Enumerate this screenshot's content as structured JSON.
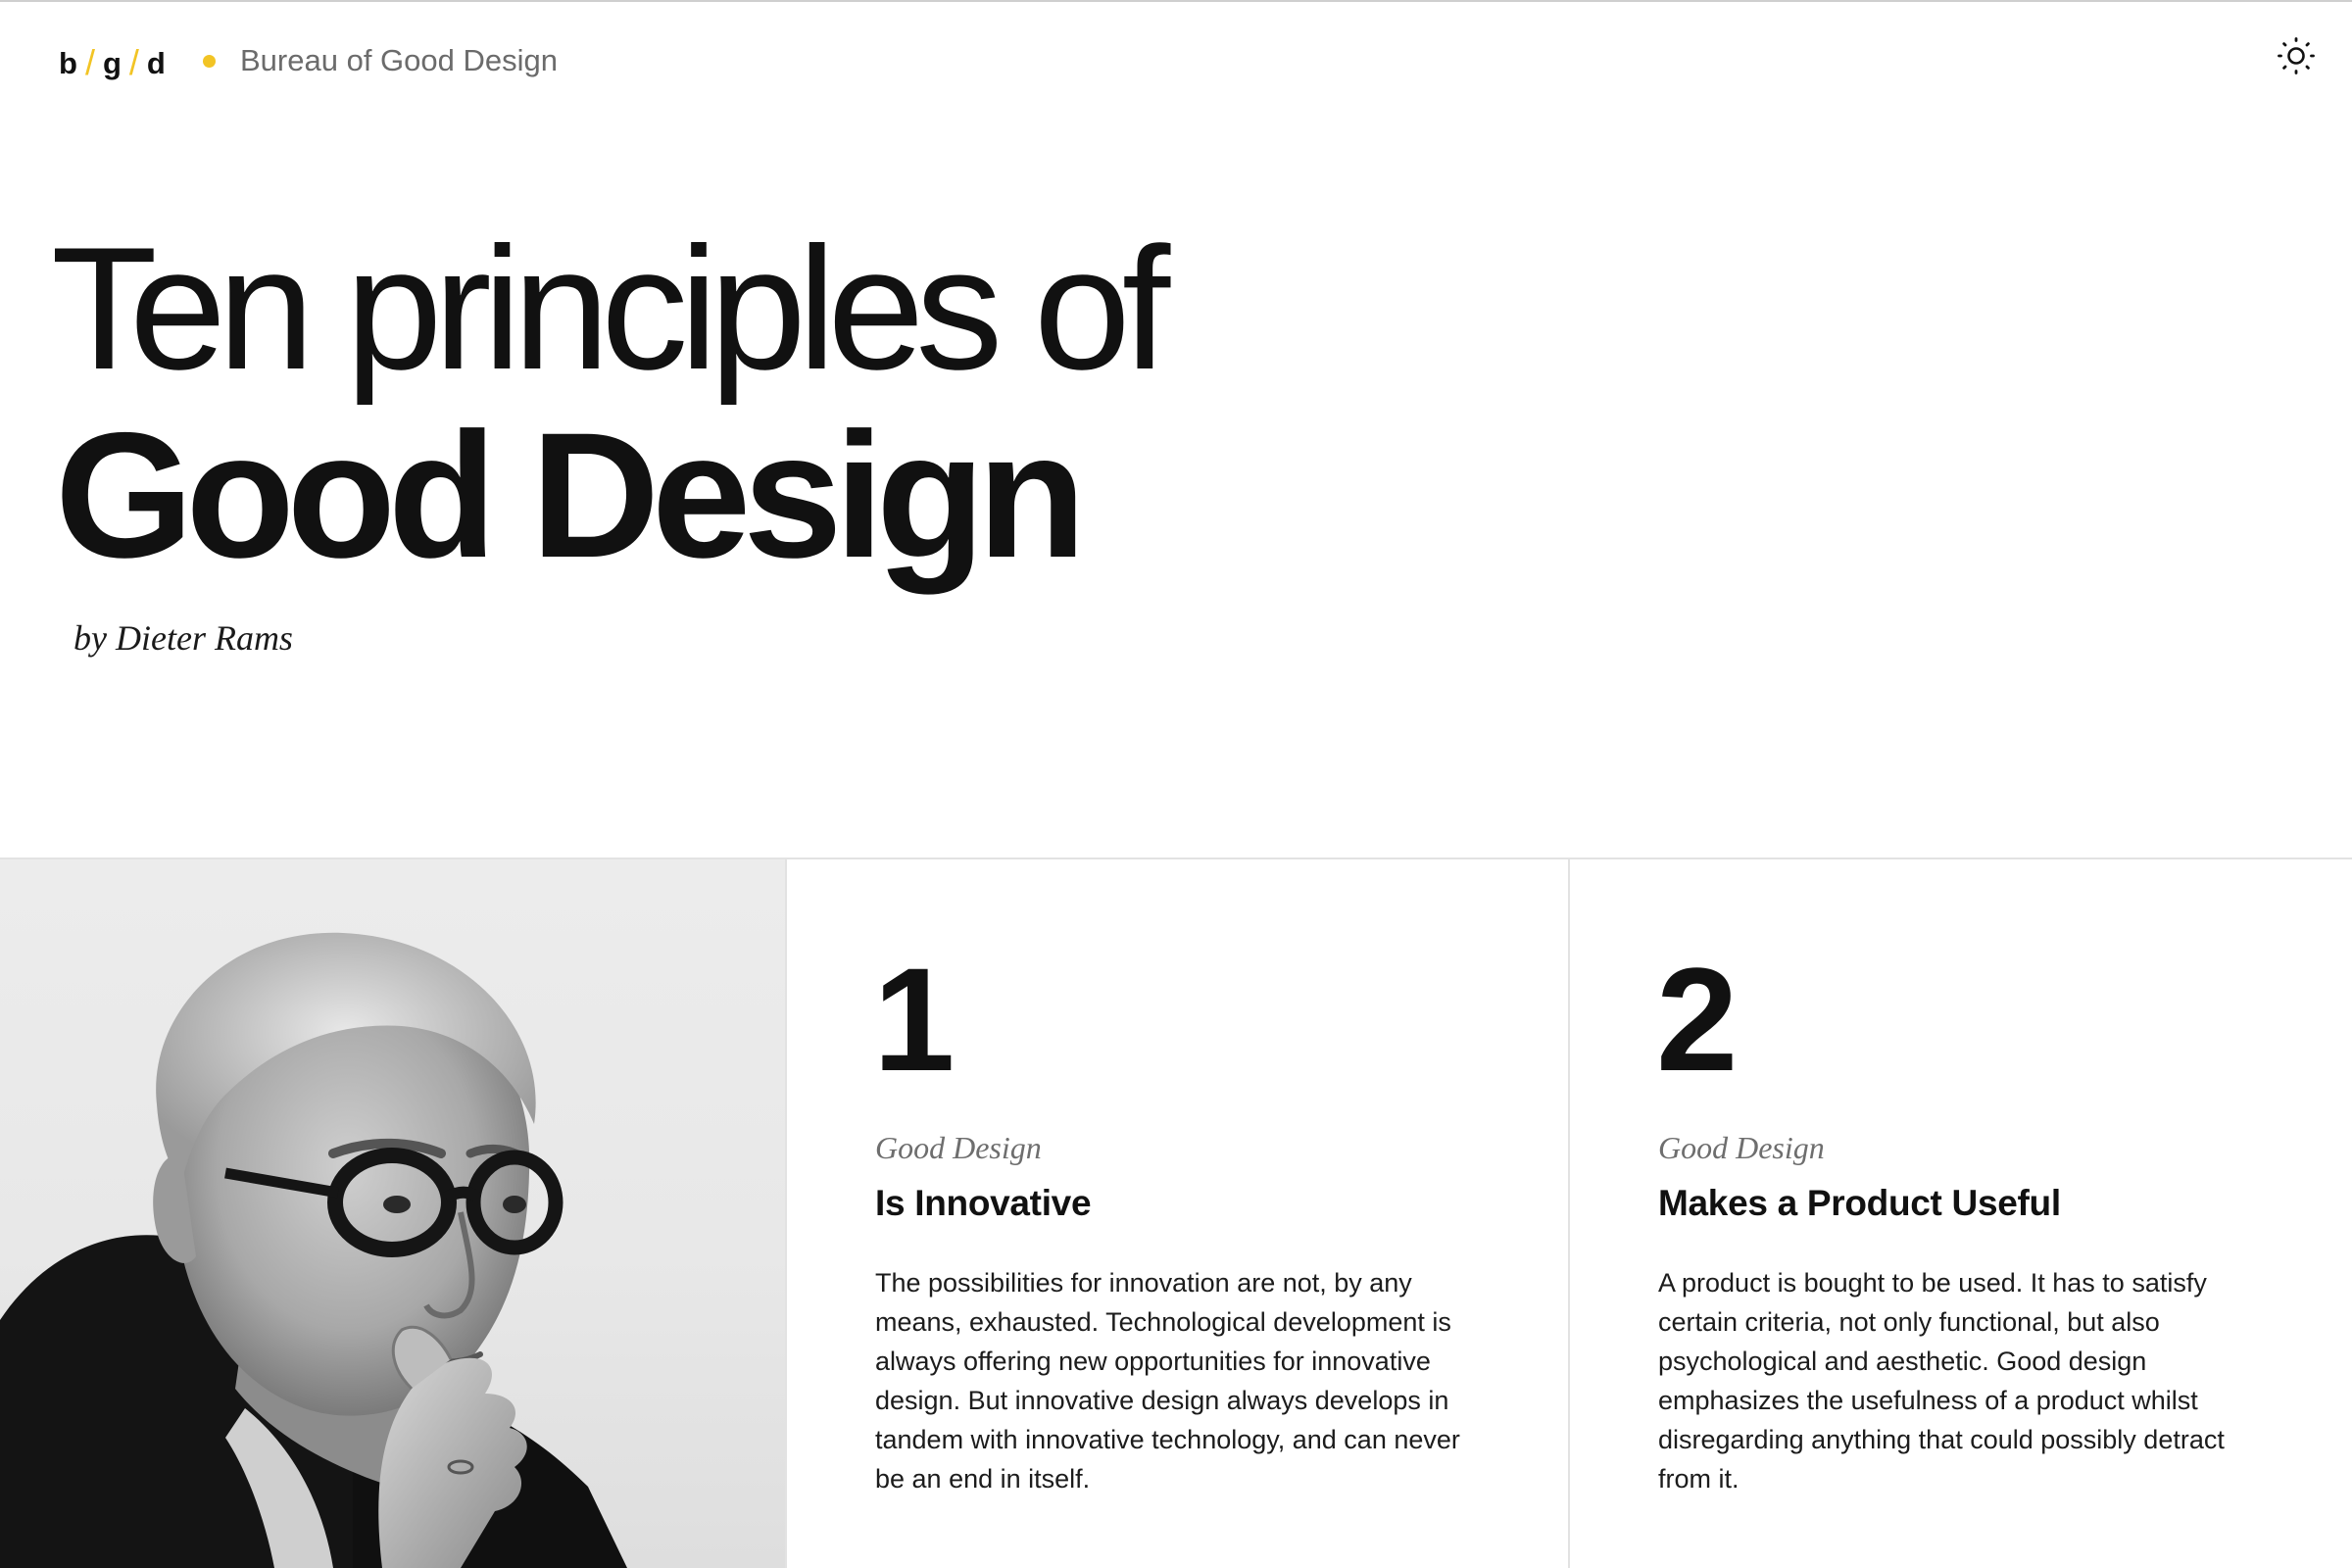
{
  "header": {
    "logo": {
      "b": "b",
      "g": "g",
      "d": "d",
      "separator": "/"
    },
    "brand_name": "Bureau of Good Design",
    "theme_toggle_icon": "sun-icon"
  },
  "hero": {
    "line1": "Ten principles of",
    "line2": "Good Design",
    "byline": "by Dieter Rams"
  },
  "portrait": {
    "icon": "portrait-photo"
  },
  "principles": [
    {
      "number": "1",
      "kicker": "Good Design",
      "title": "Is Innovative",
      "body": "The possibilities for innovation are not, by any means, exhausted. Technological development is always offering new opportunities for innovative design. But innovative design always develops in tandem with innovative technology, and can never be an end in itself."
    },
    {
      "number": "2",
      "kicker": "Good Design",
      "title": "Makes a Product Useful",
      "body": "A product is bought to be used. It has to satisfy certain criteria, not only functional, but also psychological and aesthetic. Good design emphasizes the usefulness of a product whilst disregarding anything that could possibly detract from it."
    }
  ],
  "colors": {
    "accent": "#f2c425",
    "text": "#111111",
    "muted": "#6b6b6b",
    "border": "#e2e2e2",
    "background": "#ffffff"
  }
}
